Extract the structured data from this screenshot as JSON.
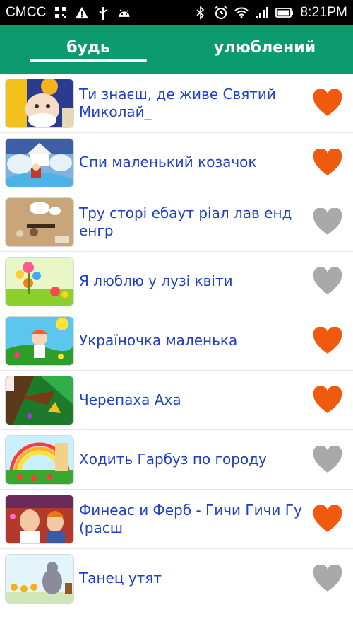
{
  "status_bar": {
    "carrier": "СМСС",
    "time": "8:21PM"
  },
  "tabs": [
    {
      "label": "будь",
      "active": true
    },
    {
      "label": "улюблений",
      "active": false
    }
  ],
  "colors": {
    "accent": "#0b9b6e",
    "title_text": "#1f3fc8",
    "heart_active": "#f05a0f",
    "heart_inactive": "#a9a9a9"
  },
  "items": [
    {
      "title": "Ти знаєш, де живе Святий Миколай_",
      "favorite": true
    },
    {
      "title": "Спи маленький козачок",
      "favorite": true
    },
    {
      "title": "Тру сторі ебаут ріал лав енд енгр",
      "favorite": false
    },
    {
      "title": "Я люблю у лузі квіти",
      "favorite": false
    },
    {
      "title": "Україночка маленька",
      "favorite": true
    },
    {
      "title": "Черепаха Аха",
      "favorite": true
    },
    {
      "title": "Ходить Гарбуз по городу",
      "favorite": false
    },
    {
      "title": "Финеас и Ферб - Гичи Гичи Гу (расш",
      "favorite": true
    },
    {
      "title": "Танец утят",
      "favorite": false
    }
  ]
}
